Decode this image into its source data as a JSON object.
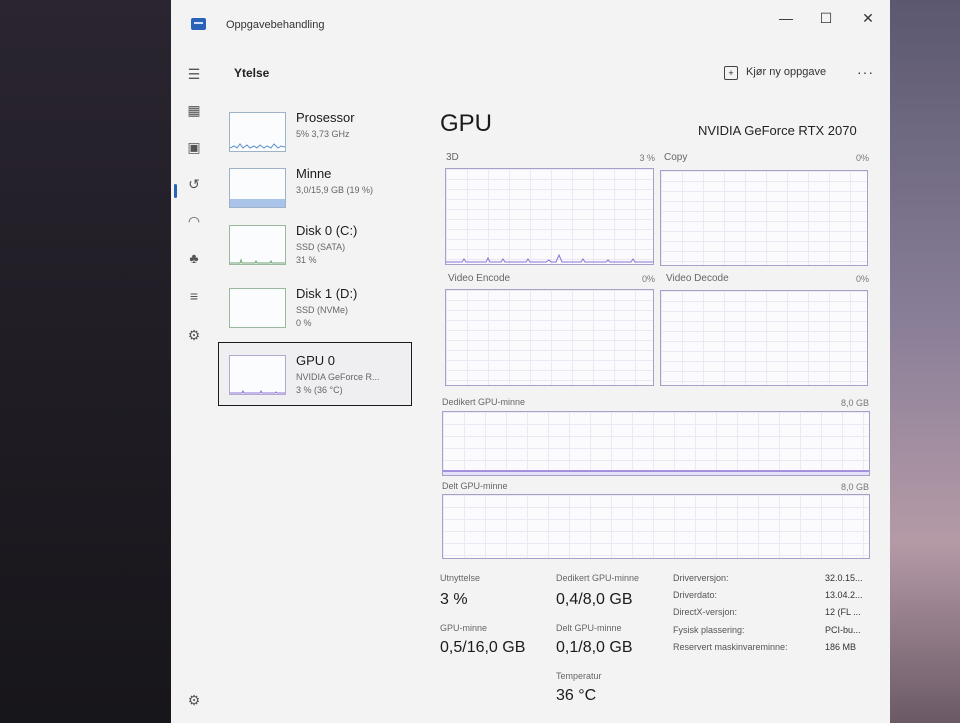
{
  "window": {
    "title": "Oppgavebehandling",
    "controls": {
      "minimize": "—",
      "maximize": "☐",
      "close": "✕"
    }
  },
  "toolbar": {
    "section_title": "Ytelse",
    "run_new_task_label": "Kjør ny oppgave",
    "more_label": "···"
  },
  "rail": {
    "items": [
      {
        "icon": "menu-icon",
        "glyph": "☰"
      },
      {
        "icon": "processes-icon",
        "glyph": "▦"
      },
      {
        "icon": "performance-icon",
        "glyph": "▣"
      },
      {
        "icon": "history-icon",
        "glyph": "↺"
      },
      {
        "icon": "startup-icon",
        "glyph": "◠"
      },
      {
        "icon": "users-icon",
        "glyph": "♣"
      },
      {
        "icon": "details-icon",
        "glyph": "≡"
      },
      {
        "icon": "services-icon",
        "glyph": "⚙"
      }
    ],
    "settings_glyph": "⚙"
  },
  "perf_items": [
    {
      "name": "Prosessor",
      "sub1": "5% 3,73 GHz",
      "sub2": ""
    },
    {
      "name": "Minne",
      "sub1": "3,0/15,9 GB (19 %)",
      "sub2": ""
    },
    {
      "name": "Disk 0 (C:)",
      "sub1": "SSD (SATA)",
      "sub2": "31 %"
    },
    {
      "name": "Disk 1 (D:)",
      "sub1": "SSD (NVMe)",
      "sub2": "0 %"
    },
    {
      "name": "GPU 0",
      "sub1": "NVIDIA GeForce R...",
      "sub2": "3 % (36 °C)"
    }
  ],
  "gpu": {
    "title": "GPU",
    "model": "NVIDIA GeForce RTX 2070",
    "engines": [
      {
        "label": "3D",
        "pct": "3 %"
      },
      {
        "label": "Copy",
        "pct": "0%"
      },
      {
        "label": "Video Encode",
        "pct": "0%"
      },
      {
        "label": "Video Decode",
        "pct": "0%"
      }
    ],
    "dedicated_memory": {
      "label": "Dedikert GPU-minne",
      "max": "8,0 GB"
    },
    "shared_memory": {
      "label": "Delt GPU-minne",
      "max": "8,0 GB"
    },
    "stats": {
      "utilization_label": "Utnyttelse",
      "utilization_value": "3 %",
      "dedicated_label": "Dedikert GPU-minne",
      "dedicated_value": "0,4/8,0 GB",
      "gpu_memory_label": "GPU-minne",
      "gpu_memory_value": "0,5/16,0 GB",
      "shared_label": "Delt GPU-minne",
      "shared_value": "0,1/8,0 GB",
      "temperature_label": "Temperatur",
      "temperature_value": "36 °C"
    },
    "info": [
      {
        "label": "Driverversjon:",
        "value": "32.0.15..."
      },
      {
        "label": "Driverdato:",
        "value": "13.04.2..."
      },
      {
        "label": "DirectX-versjon:",
        "value": "12 (FL ..."
      },
      {
        "label": "Fysisk plassering:",
        "value": "PCI-bu..."
      },
      {
        "label": "Reservert maskinvareminne:",
        "value": "186 MB"
      }
    ]
  },
  "colors": {
    "accent": "#2a62b8",
    "gpu_line": "#8b72d6",
    "memory_fill": "#a9c4e8"
  }
}
